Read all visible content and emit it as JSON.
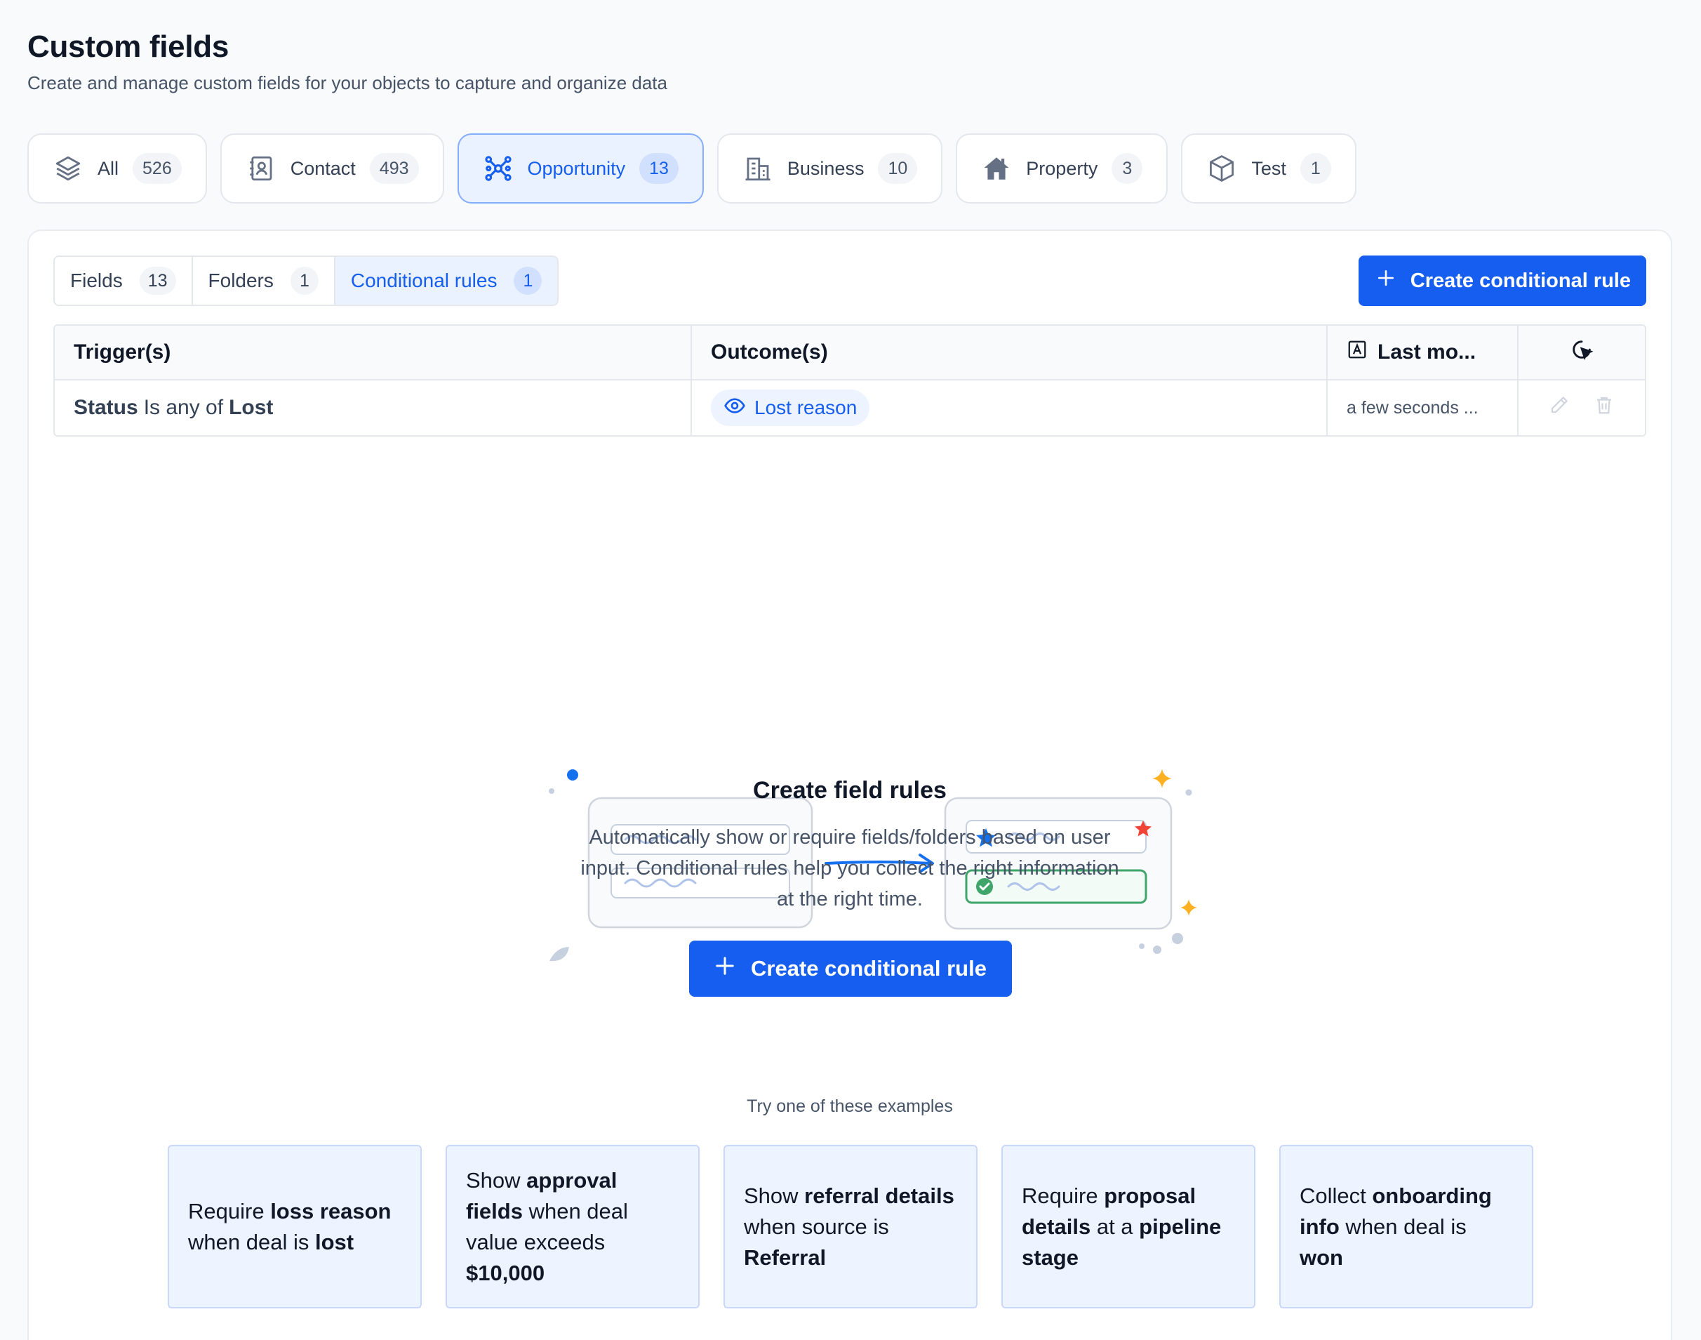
{
  "header": {
    "title": "Custom fields",
    "subtitle": "Create and manage custom fields for your objects to capture and organize data"
  },
  "object_tabs": [
    {
      "label": "All",
      "count": "526",
      "icon": "layers-icon"
    },
    {
      "label": "Contact",
      "count": "493",
      "icon": "contact-book-icon"
    },
    {
      "label": "Opportunity",
      "count": "13",
      "icon": "network-icon",
      "active": true
    },
    {
      "label": "Business",
      "count": "10",
      "icon": "building-icon"
    },
    {
      "label": "Property",
      "count": "3",
      "icon": "house-icon"
    },
    {
      "label": "Test",
      "count": "1",
      "icon": "cube-icon"
    }
  ],
  "sub_tabs": [
    {
      "label": "Fields",
      "count": "13"
    },
    {
      "label": "Folders",
      "count": "1"
    },
    {
      "label": "Conditional rules",
      "count": "1",
      "active": true
    }
  ],
  "create_button_label": "Create conditional rule",
  "table": {
    "headers": {
      "trigger": "Trigger(s)",
      "outcome": "Outcome(s)",
      "last_modified": "Last mo..."
    },
    "rows": [
      {
        "trigger_field": "Status",
        "trigger_operator": "Is any of",
        "trigger_value": "Lost",
        "outcome": "Lost reason",
        "last_modified": "a few seconds ..."
      }
    ]
  },
  "empty_state": {
    "title": "Create field rules",
    "description": "Automatically show or require fields/folders based on user input. Conditional rules help you collect the right information at the right time.",
    "button_label": "Create conditional rule",
    "examples_label": "Try one of these examples"
  },
  "examples": [
    {
      "parts": [
        "Require ",
        "loss reason",
        " when deal is ",
        "lost",
        ""
      ]
    },
    {
      "parts": [
        "Show ",
        "approval fields",
        " when deal value exceeds ",
        "$10,000",
        ""
      ]
    },
    {
      "parts": [
        "Show ",
        "referral details",
        " when source is ",
        "Referral",
        ""
      ]
    },
    {
      "parts": [
        "Require ",
        "proposal details",
        " at a ",
        "pipeline stage",
        ""
      ]
    },
    {
      "parts": [
        "Collect ",
        "onboarding info",
        " when deal is ",
        "won",
        ""
      ]
    }
  ],
  "colors": {
    "primary": "#155eef",
    "active_tab_bg": "#eaf2ff",
    "success": "#3fa56b",
    "star_red": "#f04438",
    "sparkle": "#fdb022"
  }
}
